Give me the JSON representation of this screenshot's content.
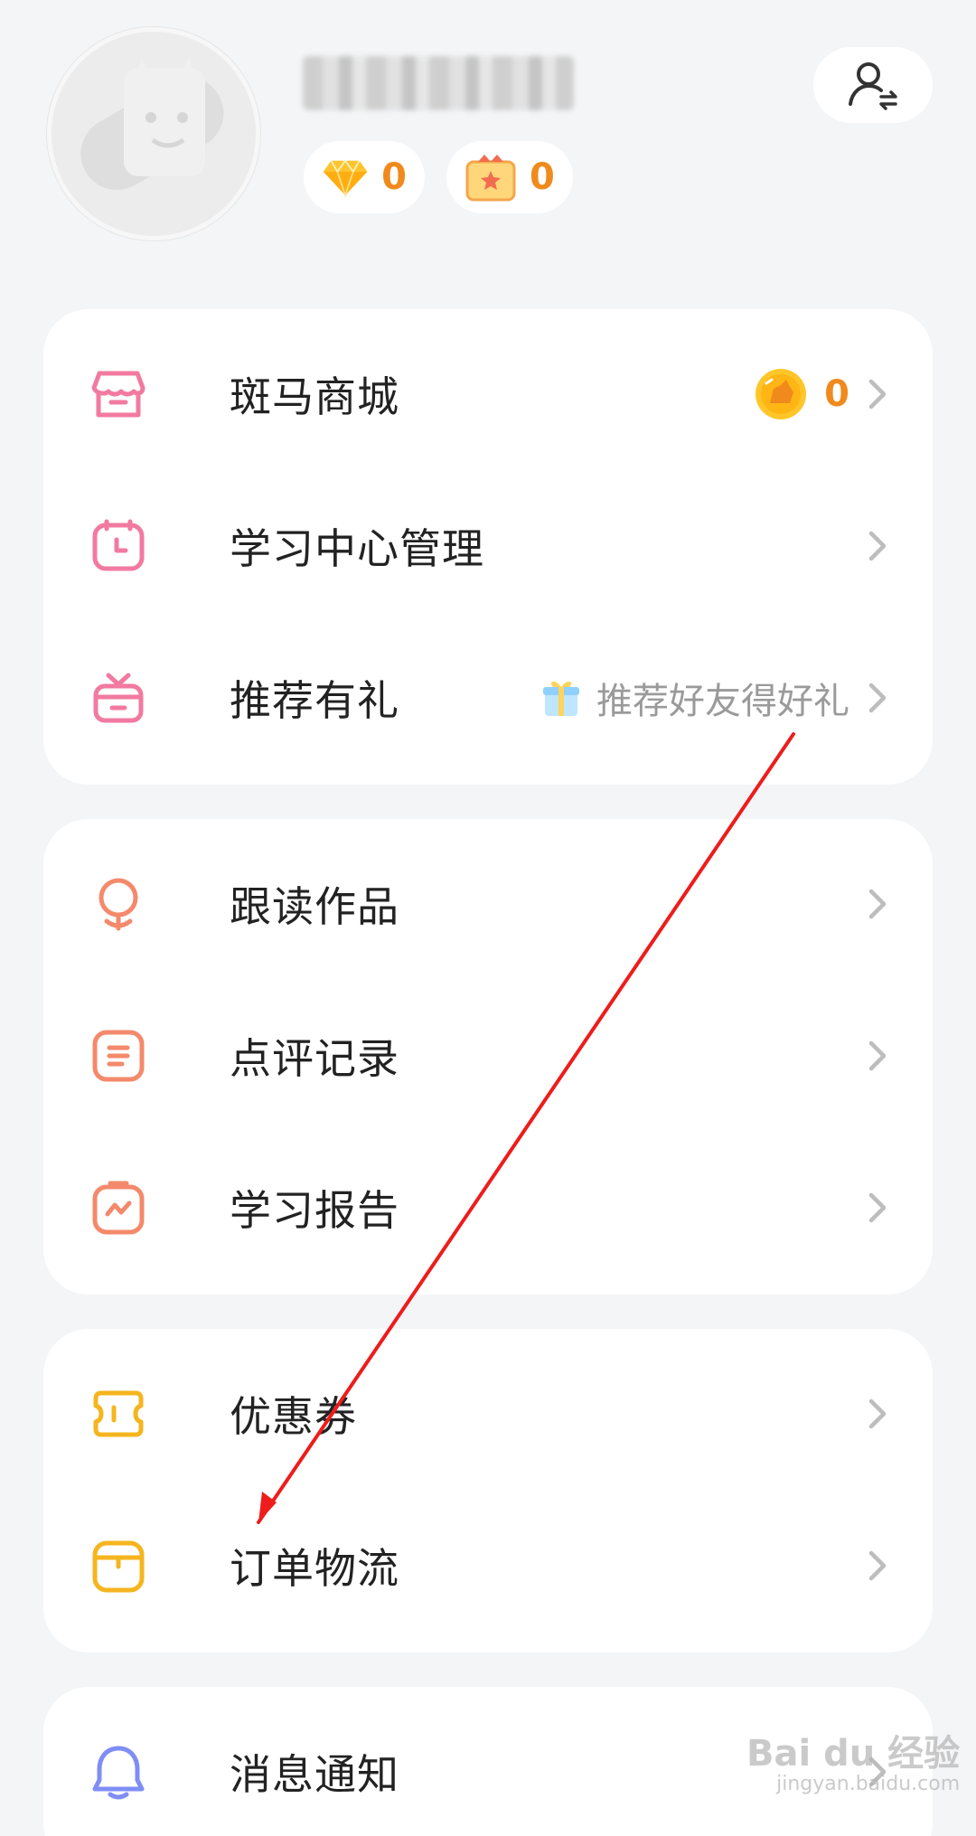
{
  "header": {
    "diamond_count": "0",
    "gift_count": "0"
  },
  "card1": {
    "items": [
      {
        "label": "斑马商城",
        "coin_value": "0"
      },
      {
        "label": "学习中心管理"
      },
      {
        "label": "推荐有礼",
        "hint": "推荐好友得好礼"
      }
    ]
  },
  "card2": {
    "items": [
      {
        "label": "跟读作品"
      },
      {
        "label": "点评记录"
      },
      {
        "label": "学习报告"
      }
    ]
  },
  "card3": {
    "items": [
      {
        "label": "优惠券"
      },
      {
        "label": "订单物流"
      }
    ]
  },
  "card4": {
    "items": [
      {
        "label": "消息通知"
      }
    ]
  },
  "watermark": {
    "brand": "Bai du 经验",
    "url": "jingyan.baidu.com"
  },
  "colors": {
    "pink": "#f27aa0",
    "orange": "#f4896b",
    "yellow": "#f5b51f",
    "purple": "#7f8df5",
    "accent_number": "#f08a1c",
    "arrow": "#ee1c1c"
  },
  "icons": {
    "mall": "store-icon",
    "learning_center": "calendar-clock-icon",
    "referral": "gift-icon",
    "works": "microphone-icon",
    "reviews": "message-icon",
    "report": "report-icon",
    "coupon": "coupon-icon",
    "orders": "package-icon",
    "notifications": "bell-icon"
  }
}
